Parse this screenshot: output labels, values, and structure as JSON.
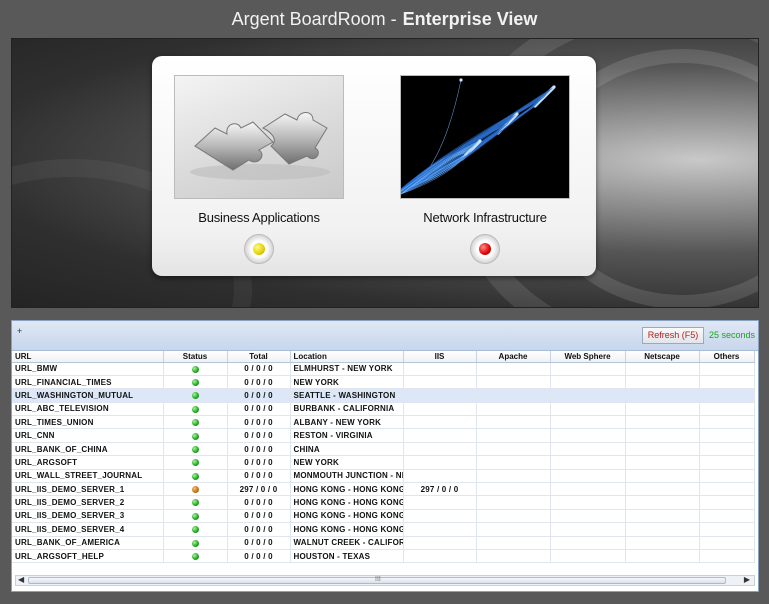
{
  "header": {
    "title_regular": "Argent BoardRoom -",
    "title_bold": "Enterprise View"
  },
  "tiles": [
    {
      "label": "Business Applications",
      "status_color": "#e5d000"
    },
    {
      "label": "Network Infrastructure",
      "status_color": "#e00000"
    }
  ],
  "grid": {
    "expander": "+",
    "refresh_label": "Refresh (F5)",
    "refresh_interval": "25 seconds",
    "columns": [
      "URL",
      "Status",
      "Total",
      "Location",
      "IIS",
      "Apache",
      "Web Sphere",
      "Netscape",
      "Others"
    ],
    "rows": [
      {
        "url": "URL_BMW",
        "status": "green",
        "total": "0 / 0 / 0",
        "location": "ELMHURST - NEW YORK",
        "iis": ""
      },
      {
        "url": "URL_FINANCIAL_TIMES",
        "status": "green",
        "total": "0 / 0 / 0",
        "location": "NEW YORK",
        "iis": ""
      },
      {
        "url": "URL_WASHINGTON_MUTUAL",
        "status": "green",
        "total": "0 / 0 / 0",
        "location": "SEATTLE - WASHINGTON",
        "iis": "",
        "selected": true
      },
      {
        "url": "URL_ABC_TELEVISION",
        "status": "green",
        "total": "0 / 0 / 0",
        "location": "BURBANK - CALIFORNIA",
        "iis": ""
      },
      {
        "url": "URL_TIMES_UNION",
        "status": "green",
        "total": "0 / 0 / 0",
        "location": "ALBANY - NEW YORK",
        "iis": ""
      },
      {
        "url": "URL_CNN",
        "status": "green",
        "total": "0 / 0 / 0",
        "location": "RESTON - VIRGINIA",
        "iis": ""
      },
      {
        "url": "URL_BANK_OF_CHINA",
        "status": "green",
        "total": "0 / 0 / 0",
        "location": "CHINA",
        "iis": ""
      },
      {
        "url": "URL_ARGSOFT",
        "status": "green",
        "total": "0 / 0 / 0",
        "location": "NEW YORK",
        "iis": ""
      },
      {
        "url": "URL_WALL_STREET_JOURNAL",
        "status": "green",
        "total": "0 / 0 / 0",
        "location": "MONMOUTH JUNCTION - NI",
        "iis": ""
      },
      {
        "url": "URL_IIS_DEMO_SERVER_1",
        "status": "orange",
        "total": "297 / 0 / 0",
        "location": "HONG KONG - HONG KONG",
        "iis": "297 / 0 / 0"
      },
      {
        "url": "URL_IIS_DEMO_SERVER_2",
        "status": "green",
        "total": "0 / 0 / 0",
        "location": "HONG KONG - HONG KONG",
        "iis": ""
      },
      {
        "url": "URL_IIS_DEMO_SERVER_3",
        "status": "green",
        "total": "0 / 0 / 0",
        "location": "HONG KONG - HONG KONG",
        "iis": ""
      },
      {
        "url": "URL_IIS_DEMO_SERVER_4",
        "status": "green",
        "total": "0 / 0 / 0",
        "location": "HONG KONG - HONG KONG",
        "iis": ""
      },
      {
        "url": "URL_BANK_OF_AMERICA",
        "status": "green",
        "total": "0 / 0 / 0",
        "location": "WALNUT CREEK - CALIFORI",
        "iis": ""
      },
      {
        "url": "URL_ARGSOFT_HELP",
        "status": "green",
        "total": "0 / 0 / 0",
        "location": "HOUSTON - TEXAS",
        "iis": ""
      }
    ],
    "scroll_grip": "III"
  },
  "icons": {
    "tile_0_image": "puzzle-pieces-icon",
    "tile_1_image": "fiber-optic-icon",
    "scroll_left": "triangle-left-icon",
    "scroll_right": "triangle-right-icon"
  }
}
